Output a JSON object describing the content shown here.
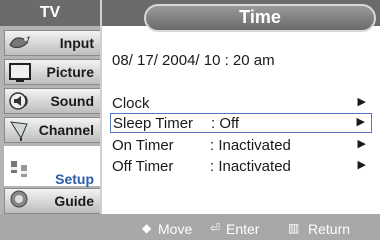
{
  "sidebar": {
    "title": "TV",
    "items": [
      {
        "label": "Input",
        "icon": "input-icon"
      },
      {
        "label": "Picture",
        "icon": "picture-icon"
      },
      {
        "label": "Sound",
        "icon": "sound-icon"
      },
      {
        "label": "Channel",
        "icon": "channel-icon"
      },
      {
        "label": "Setup",
        "icon": "setup-icon",
        "active": true
      },
      {
        "label": "Guide",
        "icon": "guide-icon"
      }
    ]
  },
  "panel": {
    "title": "Time",
    "datetime": "08/ 17/ 2004/ 10 : 20 am",
    "rows": [
      {
        "label": "Clock",
        "value": "",
        "arrow": "▶"
      },
      {
        "label": "Sleep Timer",
        "value": ": Off",
        "arrow": "▶",
        "selected": true
      },
      {
        "label": "On Timer",
        "value": ": Inactivated",
        "arrow": "▶"
      },
      {
        "label": "Off Timer",
        "value": ": Inactivated",
        "arrow": "▶"
      }
    ]
  },
  "footer": {
    "move_label": "Move",
    "enter_label": "Enter",
    "return_label": "Return"
  },
  "colors": {
    "active_accent": "#2a5caa",
    "title_bar": "#6b6b6b",
    "sidebar_bg": "#b3b3b3"
  }
}
